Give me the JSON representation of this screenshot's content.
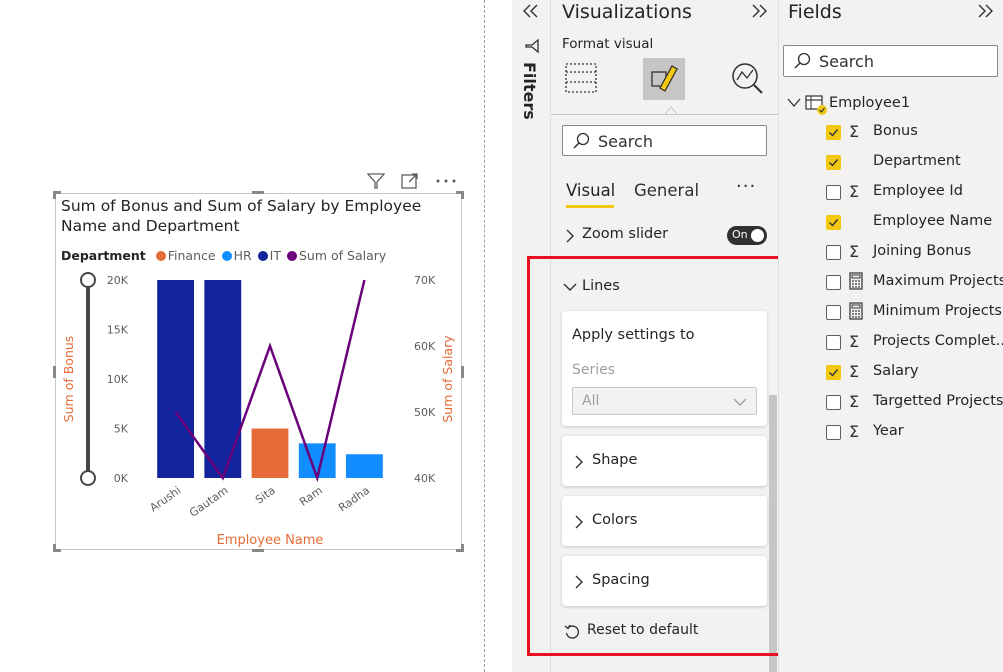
{
  "chart": {
    "title": "Sum of Bonus and Sum of Salary by Employee Name and Department",
    "legend_title": "Department",
    "legend": [
      {
        "label": "Finance",
        "color": "#e66c37"
      },
      {
        "label": "HR",
        "color": "#118dff"
      },
      {
        "label": "IT",
        "color": "#12239e"
      },
      {
        "label": "Sum of Salary",
        "color": "#6b007b"
      }
    ],
    "xlabel": "Employee Name",
    "ylabel_left": "Sum of Bonus",
    "ylabel_right": "Sum of Salary",
    "left_ticks": [
      "20K",
      "15K",
      "10K",
      "5K",
      "0K"
    ],
    "right_ticks": [
      "70K",
      "60K",
      "50K",
      "40K"
    ]
  },
  "chart_data": {
    "type": "bar",
    "categories": [
      "Arushi",
      "Gautam",
      "Sita",
      "Ram",
      "Radha"
    ],
    "series": [
      {
        "name": "Sum of Bonus",
        "values": [
          20000,
          20000,
          5000,
          3500,
          2400
        ],
        "departments": [
          "IT",
          "IT",
          "Finance",
          "HR",
          "HR"
        ]
      },
      {
        "name": "Sum of Salary",
        "values": [
          50000,
          40000,
          60000,
          40000,
          70000
        ]
      }
    ],
    "title": "Sum of Bonus and Sum of Salary by Employee Name and Department",
    "xlabel": "Employee Name",
    "ylabel": "Sum of Bonus",
    "y2label": "Sum of Salary",
    "ylim": [
      0,
      20000
    ],
    "y2lim": [
      40000,
      70000
    ],
    "legend_position": "top",
    "grid": false,
    "zoom_slider": true,
    "colors": {
      "IT": "#12239e",
      "Finance": "#e66c37",
      "HR": "#118dff",
      "Sum of Salary": "#6b007b"
    }
  },
  "filters": {
    "label": "Filters"
  },
  "viz": {
    "title": "Visualizations",
    "subtitle": "Format visual",
    "search_placeholder": "Search",
    "tab_visual": "Visual",
    "tab_general": "General",
    "more": "···",
    "zoom_slider": "Zoom slider",
    "zoom_toggle": "On",
    "lines": "Lines",
    "apply_settings": "Apply settings to",
    "series_label": "Series",
    "series_value": "All",
    "shape": "Shape",
    "colors_label": "Colors",
    "spacing": "Spacing",
    "reset": "Reset to default"
  },
  "fields": {
    "title": "Fields",
    "search_placeholder": "Search",
    "table": "Employee1",
    "items": [
      {
        "label": "Bonus",
        "checked": true,
        "glyph": "Σ"
      },
      {
        "label": "Department",
        "checked": true,
        "glyph": ""
      },
      {
        "label": "Employee Id",
        "checked": false,
        "glyph": "Σ"
      },
      {
        "label": "Employee Name",
        "checked": true,
        "glyph": ""
      },
      {
        "label": "Joining Bonus",
        "checked": false,
        "glyph": "Σ"
      },
      {
        "label": "Maximum Projects",
        "checked": false,
        "glyph": "calc"
      },
      {
        "label": "Minimum Projects",
        "checked": false,
        "glyph": "calc"
      },
      {
        "label": "Projects Complet...",
        "checked": false,
        "glyph": "Σ"
      },
      {
        "label": "Salary",
        "checked": true,
        "glyph": "Σ"
      },
      {
        "label": "Targetted Projects",
        "checked": false,
        "glyph": "Σ"
      },
      {
        "label": "Year",
        "checked": false,
        "glyph": "Σ"
      }
    ]
  }
}
